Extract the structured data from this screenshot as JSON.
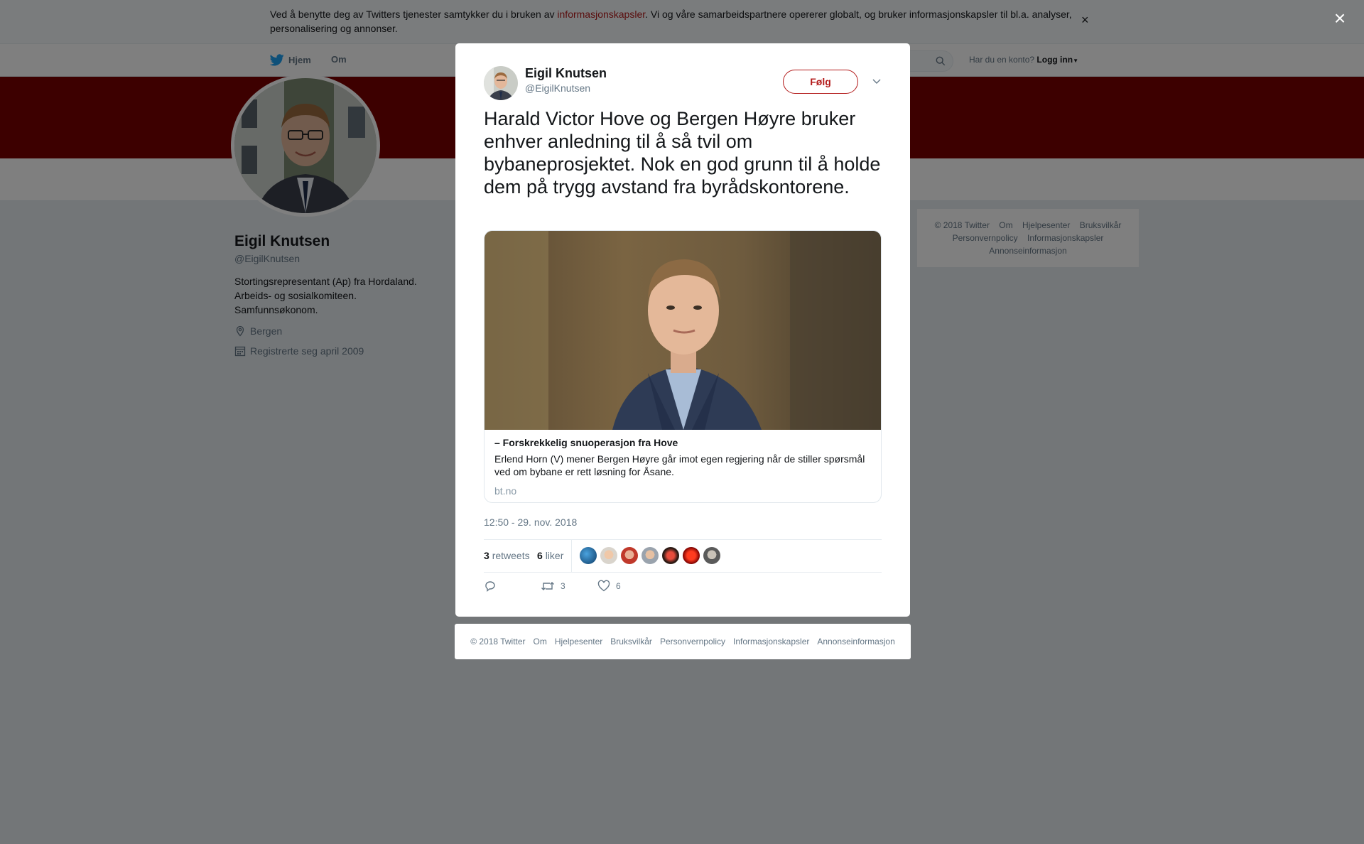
{
  "cookie_bar": {
    "text_before": "Ved å benytte deg av Twitters tjenester samtykker du i bruken av ",
    "link": "informasjonskapsler",
    "text_after": ". Vi og våre samarbeidspartnere opererer globalt, og bruker informasjonskapsler til bl.a. analyser, personalisering og annonser.",
    "close": "×"
  },
  "nav": {
    "home": "Hjem",
    "about": "Om",
    "account_prompt": "Har du en konto?",
    "login": "Logg inn"
  },
  "profile": {
    "name": "Eigil Knutsen",
    "handle": "@EigilKnutsen",
    "bio_lines": [
      "Stortingsrepresentant (Ap) fra Hordaland.",
      "Arbeids- og sosialkomiteen.",
      "Samfunnsøkonom."
    ],
    "location": "Bergen",
    "joined": "Registrerte seg april 2009"
  },
  "side_footer": {
    "links": [
      "© 2018 Twitter",
      "Om",
      "Hjelpesenter",
      "Bruksvilkår",
      "Personvernpolicy",
      "Informasjonskapsler",
      "Annonseinformasjon"
    ]
  },
  "modal": {
    "close": "×",
    "author_name": "Eigil Knutsen",
    "author_handle": "@EigilKnutsen",
    "follow": "Følg",
    "tweet_text": "Harald Victor Hove og Bergen Høyre bruker enhver anledning til å så tvil om bybaneprosjektet. Nok en god grunn til å holde dem på trygg avstand fra byrådskontorene.",
    "card": {
      "title": "– Forskrekkelig snuoperasjon fra Hove",
      "description": "Erlend Horn (V) mener Bergen Høyre går imot egen regjering når de stiller spørsmål ved om bybane er rett løsning for Åsane.",
      "domain": "bt.no"
    },
    "timestamp": "12:50 - 29. nov. 2018",
    "retweets_count": "3",
    "retweets_label": "retweets",
    "likes_count": "6",
    "likes_label": "liker",
    "action_retweet_count": "3",
    "action_like_count": "6"
  },
  "modal_footer": {
    "links": [
      "© 2018 Twitter",
      "Om",
      "Hjelpesenter",
      "Bruksvilkår",
      "Personvernpolicy",
      "Informasjonskapsler",
      "Annonseinformasjon"
    ]
  },
  "colors": {
    "brand": "#b31b1b",
    "banner": "#7a0000",
    "muted": "#657786"
  }
}
